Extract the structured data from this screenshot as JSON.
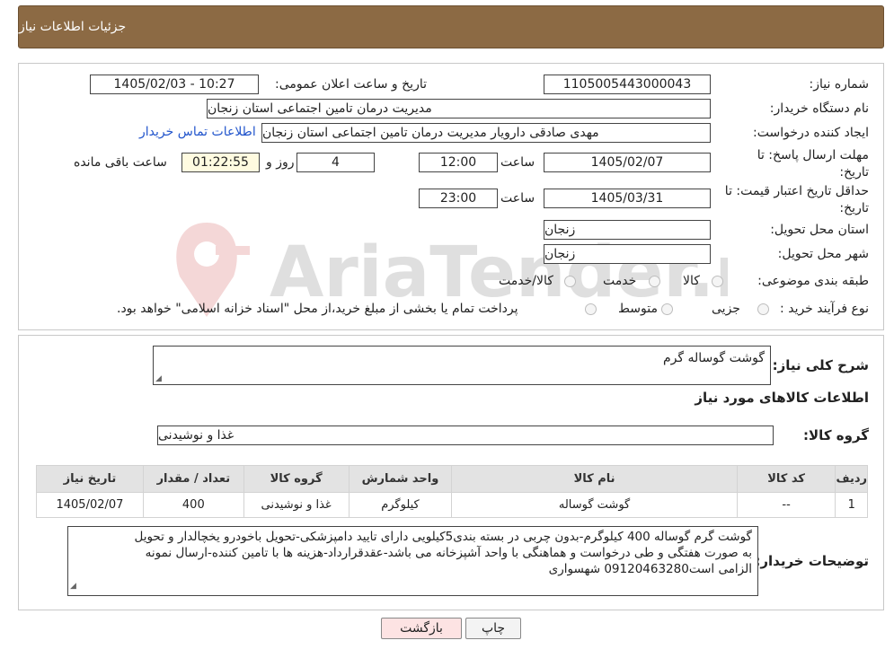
{
  "header": {
    "title": "جزئیات اطلاعات نیاز"
  },
  "form": {
    "need_number_label": "شماره نیاز:",
    "need_number": "1105005443000043",
    "announce_label": "تاریخ و ساعت اعلان عمومی:",
    "announce_value": "1405/02/03 - 10:27",
    "buyer_org_label": "نام دستگاه خریدار:",
    "buyer_org": "مدیریت درمان تامین اجتماعی استان زنجان",
    "requester_label": "ایجاد کننده درخواست:",
    "requester": "مهدی صادقی دارویار مدیریت درمان تامین اجتماعی استان زنجان",
    "contact_link": "اطلاعات تماس خریدار",
    "deadline_label_1": "مهلت ارسال پاسخ: تا",
    "deadline_label_2": "تاریخ:",
    "deadline_date": "1405/02/07",
    "time_label": "ساعت",
    "deadline_time": "12:00",
    "days_value": "4",
    "days_label": "روز و",
    "remaining_time": "01:22:55",
    "remaining_label": "ساعت باقی مانده",
    "validity_label_1": "حداقل تاریخ اعتبار قیمت: تا",
    "validity_label_2": "تاریخ:",
    "validity_date": "1405/03/31",
    "validity_time": "23:00",
    "province_label": "استان محل تحویل:",
    "province": "زنجان",
    "city_label": "شهر محل تحویل:",
    "city": "زنجان",
    "category_label": "طبقه بندی موضوعی:",
    "category_options": [
      "کالا",
      "خدمت",
      "کالا/خدمت"
    ],
    "process_label": "نوع فرآیند خرید :",
    "process_options": [
      "جزیی",
      "متوسط"
    ],
    "process_note": "پرداخت تمام یا بخشی از مبلغ خرید،از محل \"اسناد خزانه اسلامی\" خواهد بود."
  },
  "summary": {
    "desc_label": "شرح کلی نیاز:",
    "desc_value": "گوشت گوساله گرم",
    "items_title": "اطلاعات کالاهای مورد نیاز",
    "group_label": "گروه کالا:",
    "group_value": "غذا و نوشیدنی"
  },
  "table": {
    "headers": [
      "ردیف",
      "کد کالا",
      "نام کالا",
      "واحد شمارش",
      "گروه کالا",
      "تعداد / مقدار",
      "تاریخ نیاز"
    ],
    "rows": [
      [
        "1",
        "--",
        "گوشت گوساله",
        "کیلوگرم",
        "غذا و نوشیدنی",
        "400",
        "1405/02/07"
      ]
    ]
  },
  "notes": {
    "label": "توضیحات خریدار:",
    "line1": "گوشت گرم گوساله 400 کیلوگرم-بدون چربی در بسته بندی5کیلویی دارای تایید دامپزشکی-تحویل باخودرو یخچالدار و تحویل",
    "line2": "به صورت هفتگی و طی درخواست و هماهنگی با واحد آشپزخانه می باشد-عقدقرارداد-هزینه ها با تامین کننده-ارسال نمونه",
    "line3": "الزامی است09120463280 شهسواری"
  },
  "buttons": {
    "back": "بازگشت",
    "print": "چاپ"
  },
  "watermark": {
    "text": "AriaTender.neT"
  },
  "colors": {
    "header_bg": "#8c6a44",
    "link": "#2255cc",
    "back_button_bg": "#fde3e3",
    "remaining_bg": "#fffbe0"
  }
}
